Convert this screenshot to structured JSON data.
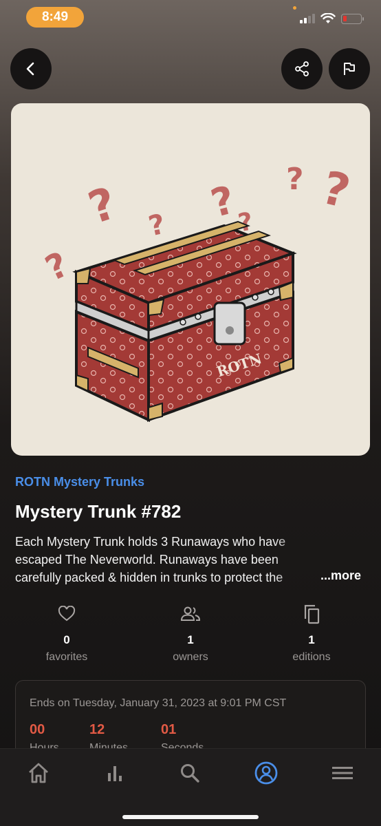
{
  "status_bar": {
    "time": "8:49",
    "accent_color": "#f2a43a",
    "battery_color": "#e3352f"
  },
  "nav": {
    "back_icon": "chevron-left-icon",
    "share_icon": "share-icon",
    "report_icon": "flag-icon"
  },
  "nft": {
    "collection": "ROTN Mystery Trunks",
    "title": "Mystery Trunk #782",
    "description": "Each Mystery Trunk holds 3 Runaways who have escaped The Neverworld. Runaways have been carefully packed & hidden in trunks to protect the",
    "more_label": "...more",
    "image_label": "ROTN"
  },
  "stats": [
    {
      "icon": "heart-icon",
      "value": "0",
      "label": "favorites"
    },
    {
      "icon": "people-icon",
      "value": "1",
      "label": "owners"
    },
    {
      "icon": "copy-icon",
      "value": "1",
      "label": "editions"
    }
  ],
  "auction": {
    "ends_text": "Ends on Tuesday, January 31, 2023 at 9:01 PM CST",
    "countdown": [
      {
        "value": "00",
        "unit": "Hours"
      },
      {
        "value": "12",
        "unit": "Minutes"
      },
      {
        "value": "01",
        "unit": "Seconds"
      }
    ],
    "countdown_color": "#e25a45"
  },
  "tabbar": {
    "tabs": [
      {
        "icon": "home-icon",
        "active": false
      },
      {
        "icon": "bar-chart-icon",
        "active": false
      },
      {
        "icon": "search-icon",
        "active": false
      },
      {
        "icon": "account-icon",
        "active": true
      },
      {
        "icon": "menu-icon",
        "active": false
      }
    ],
    "active_color": "#4a8ee8",
    "inactive_color": "#8f8b89"
  }
}
